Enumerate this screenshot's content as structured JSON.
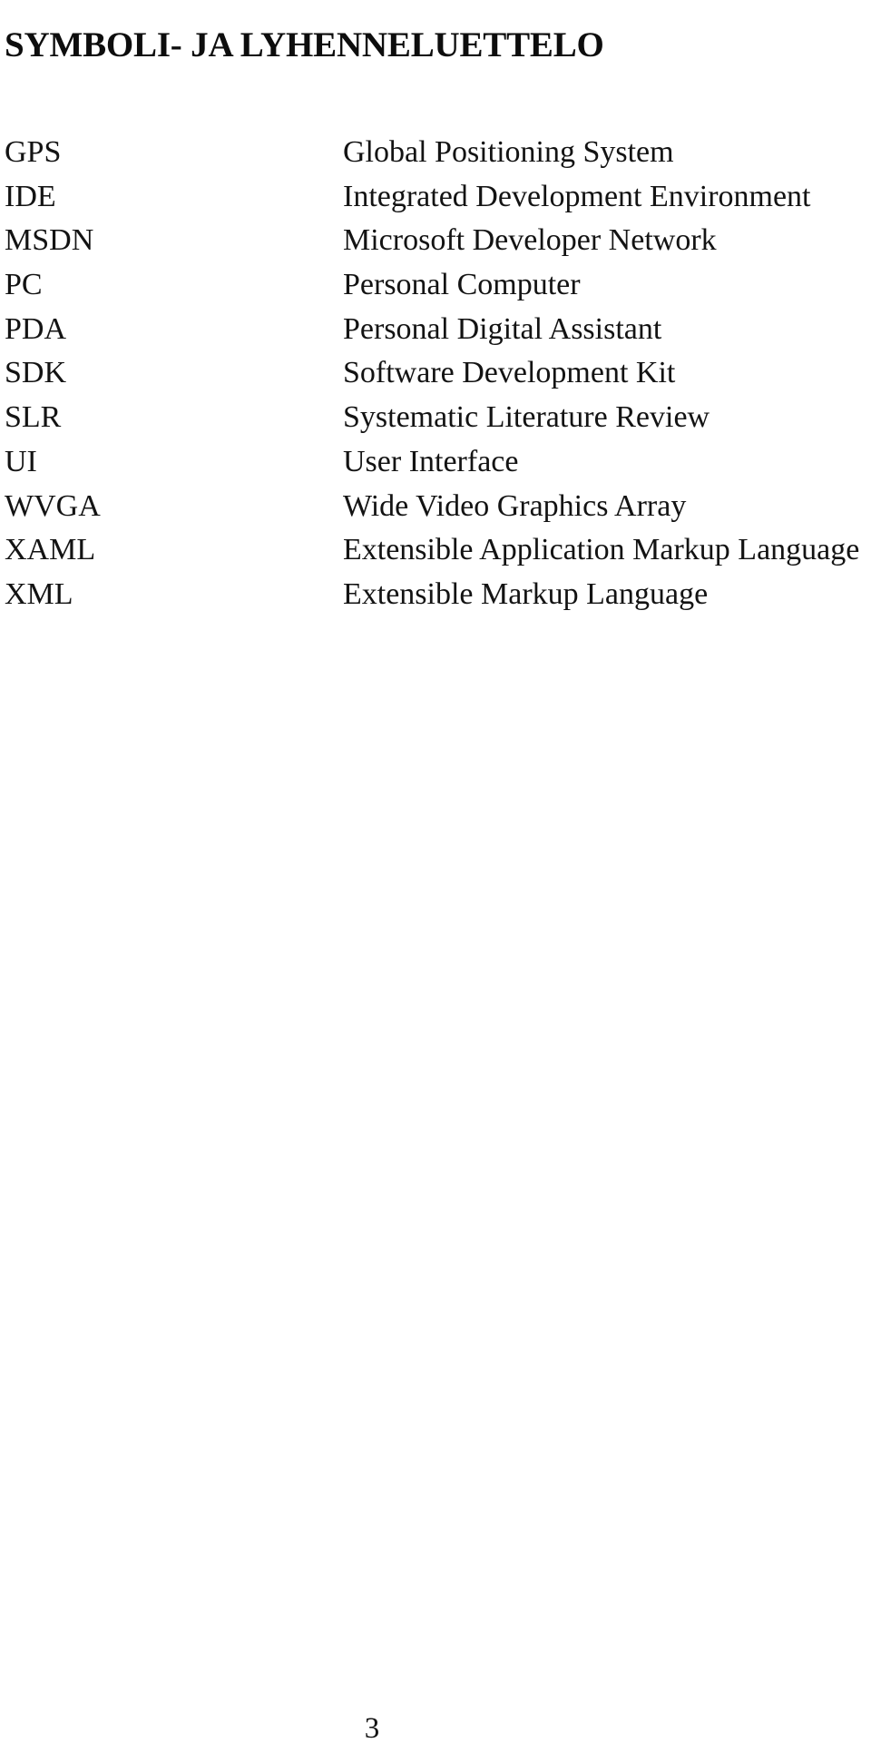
{
  "document": {
    "heading": "SYMBOLI- JA LYHENNELUETTELO",
    "page_number": "3"
  },
  "abbreviations": [
    {
      "term": "GPS",
      "definition": "Global Positioning System"
    },
    {
      "term": "IDE",
      "definition": "Integrated Development Environment"
    },
    {
      "term": "MSDN",
      "definition": "Microsoft Developer Network"
    },
    {
      "term": "PC",
      "definition": "Personal Computer"
    },
    {
      "term": "PDA",
      "definition": "Personal Digital Assistant"
    },
    {
      "term": "SDK",
      "definition": "Software Development Kit"
    },
    {
      "term": "SLR",
      "definition": "Systematic Literature Review"
    },
    {
      "term": "UI",
      "definition": "User Interface"
    },
    {
      "term": "WVGA",
      "definition": "Wide Video Graphics Array"
    },
    {
      "term": "XAML",
      "definition": "Extensible Application Markup Language"
    },
    {
      "term": "XML",
      "definition": "Extensible Markup Language"
    }
  ]
}
